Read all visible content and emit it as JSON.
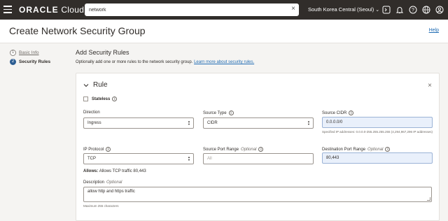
{
  "topbar": {
    "logo_brand": "ORACLE",
    "logo_product": "Cloud",
    "search_value": "network",
    "region": "South Korea Central (Seoul)",
    "icons": [
      "hamburger-icon",
      "cloud-shell-icon",
      "bell-icon",
      "help-icon",
      "globe-icon",
      "user-icon"
    ]
  },
  "header": {
    "title": "Create Network Security Group",
    "help": "Help"
  },
  "steps": [
    {
      "num": "1",
      "label": "Basic Info"
    },
    {
      "num": "2",
      "label": "Security Rules"
    }
  ],
  "main": {
    "title": "Add Security Rules",
    "desc_prefix": "Optionally add one or more rules to the network security group.",
    "desc_link": "Learn more about security rules."
  },
  "rule": {
    "title": "Rule",
    "stateless_label": "Stateless",
    "direction_label": "Direction",
    "direction_value": "Ingress",
    "source_type_label": "Source Type",
    "source_type_value": "CIDR",
    "source_cidr_label": "Source CIDR",
    "source_cidr_value": "0.0.0.0/0",
    "source_cidr_helper": "Specified IP addresses: 0.0.0.0-255.255.255.255 (4,294,967,296 IP addresses)",
    "ip_protocol_label": "IP Protocol",
    "ip_protocol_value": "TCP",
    "source_port_label": "Source Port Range",
    "source_port_optional": "Optional",
    "source_port_placeholder": "All",
    "dest_port_label": "Destination Port Range",
    "dest_port_optional": "Optional",
    "dest_port_value": "80,443",
    "allows_label": "Allows:",
    "allows_text": "Allows TCP traffic 80,443",
    "description_label": "Description",
    "description_optional": "Optional",
    "description_value": "allow http and https traffic",
    "description_helper": "Maximum 255 characters"
  }
}
